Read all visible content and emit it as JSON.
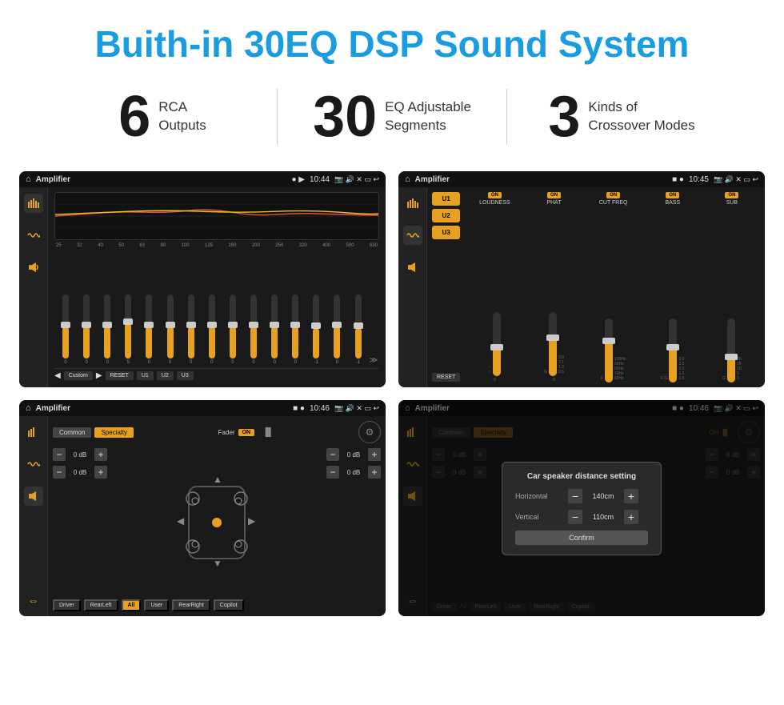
{
  "header": {
    "title": "Buith-in 30EQ DSP Sound System"
  },
  "stats": [
    {
      "number": "6",
      "label_line1": "RCA",
      "label_line2": "Outputs"
    },
    {
      "divider": true
    },
    {
      "number": "30",
      "label_line1": "EQ Adjustable",
      "label_line2": "Segments"
    },
    {
      "divider": true
    },
    {
      "number": "3",
      "label_line1": "Kinds of",
      "label_line2": "Crossover Modes"
    }
  ],
  "screens": [
    {
      "id": "eq-screen",
      "status_bar": {
        "app_name": "Amplifier",
        "icons_left": "● ▶",
        "time": "10:44",
        "icons_right": "📷 🔊 ✕ ⬜ ↩"
      },
      "type": "eq",
      "freq_labels": [
        "25",
        "32",
        "40",
        "50",
        "63",
        "80",
        "100",
        "125",
        "160",
        "200",
        "250",
        "320",
        "400",
        "500",
        "630"
      ],
      "slider_values": [
        "0",
        "0",
        "0",
        "5",
        "0",
        "0",
        "0",
        "0",
        "0",
        "0",
        "0",
        "0",
        "-1",
        "0",
        "-1"
      ],
      "bottom_buttons": [
        "Custom",
        "RESET",
        "U1",
        "U2",
        "U3"
      ]
    },
    {
      "id": "amp-screen",
      "status_bar": {
        "app_name": "Amplifier",
        "icons_left": "■ ●",
        "time": "10:45",
        "icons_right": "📷 🔊 ✕ ⬜ ↩"
      },
      "type": "amplifier",
      "presets": [
        "U1",
        "U2",
        "U3"
      ],
      "channels": [
        {
          "name": "LOUDNESS",
          "on": true
        },
        {
          "name": "PHAT",
          "on": true
        },
        {
          "name": "CUT FREQ",
          "on": true
        },
        {
          "name": "BASS",
          "on": true
        },
        {
          "name": "SUB",
          "on": true
        }
      ],
      "reset_btn": "RESET"
    },
    {
      "id": "fader-screen",
      "status_bar": {
        "app_name": "Amplifier",
        "icons_left": "■ ●",
        "time": "10:46",
        "icons_right": "📷 🔊 ✕ ⬜ ↩"
      },
      "type": "fader",
      "tabs": [
        "Common",
        "Specialty"
      ],
      "active_tab": "Specialty",
      "fader_label": "Fader",
      "fader_on": "ON",
      "controls": [
        {
          "label": "0 dB"
        },
        {
          "label": "0 dB"
        },
        {
          "label": "0 dB"
        },
        {
          "label": "0 dB"
        }
      ],
      "bottom_buttons": [
        "Driver",
        "All",
        "User",
        "RearLeft",
        "RearRight",
        "Copilot"
      ]
    },
    {
      "id": "dialog-screen",
      "status_bar": {
        "app_name": "Amplifier",
        "icons_left": "■ ●",
        "time": "10:46",
        "icons_right": "📷 🔊 ✕ ⬜ ↩"
      },
      "type": "fader-dialog",
      "dialog": {
        "title": "Car speaker distance setting",
        "horizontal_label": "Horizontal",
        "horizontal_value": "140cm",
        "vertical_label": "Vertical",
        "vertical_value": "110cm",
        "confirm_btn": "Confirm"
      },
      "controls_right": [
        {
          "label": "0 dB"
        },
        {
          "label": "0 dB"
        }
      ]
    }
  ]
}
